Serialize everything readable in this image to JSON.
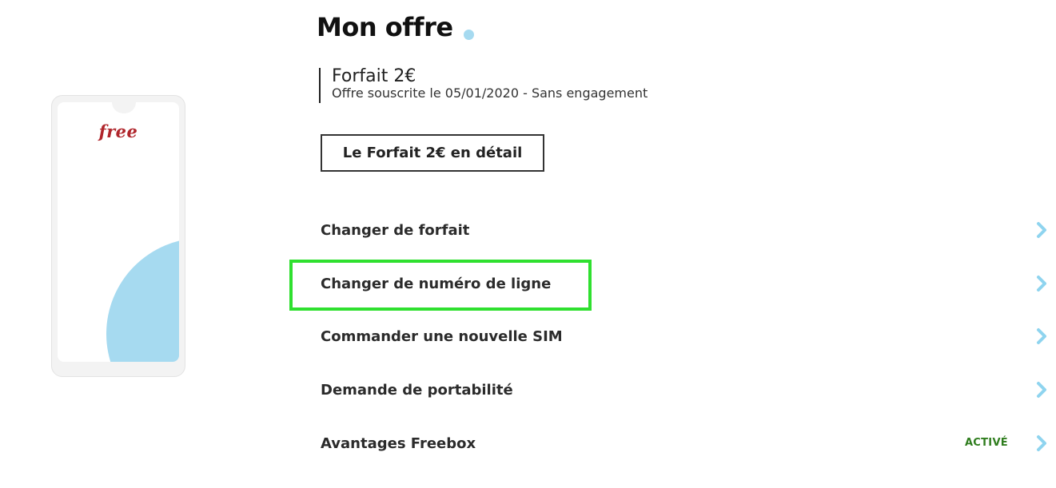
{
  "phone": {
    "logo": "free"
  },
  "header": {
    "title": "Mon offre"
  },
  "plan": {
    "name": "Forfait 2€",
    "subtitle": "Offre souscrite le 05/01/2020 - Sans engagement",
    "detail_button": "Le Forfait 2€ en détail"
  },
  "menu": {
    "items": [
      {
        "label": "Changer de forfait",
        "badge": ""
      },
      {
        "label": "Changer de numéro de ligne",
        "badge": ""
      },
      {
        "label": "Commander une nouvelle SIM",
        "badge": ""
      },
      {
        "label": "Demande de portabilité",
        "badge": ""
      },
      {
        "label": "Avantages Freebox",
        "badge": "ACTIVÉ"
      }
    ]
  },
  "colors": {
    "accent": "#a6daf0",
    "chevron": "#8fd4ef",
    "badge": "#2f7d1e",
    "highlight": "#2fe02f",
    "brand_red": "#b0262c"
  },
  "icons": {
    "chevron": "chevron-right-icon",
    "title_dot": "dot-icon"
  }
}
